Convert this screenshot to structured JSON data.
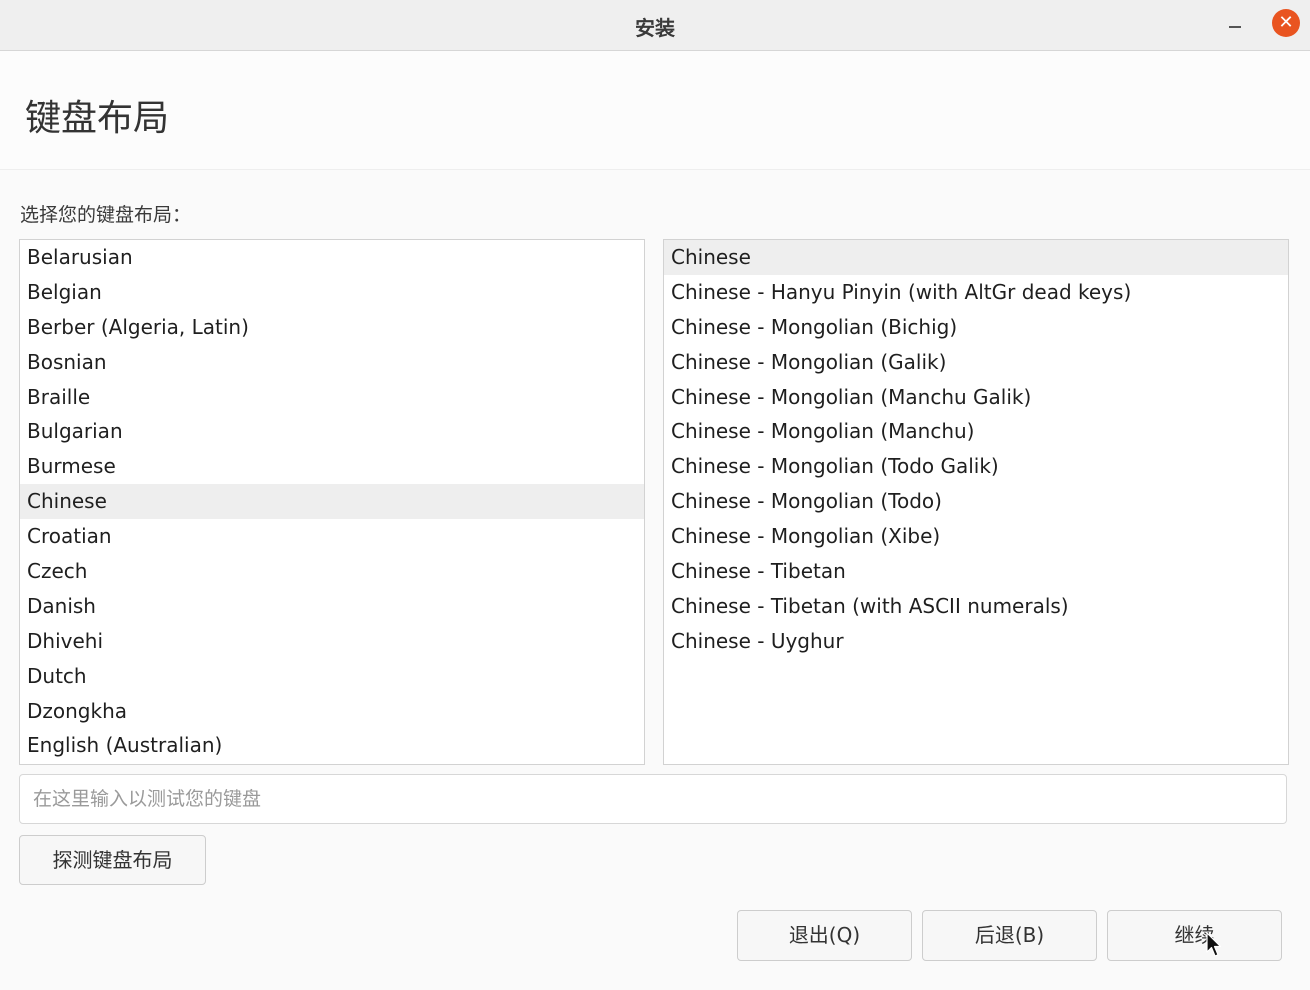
{
  "window": {
    "title": "安装"
  },
  "header": {
    "title": "键盘布局"
  },
  "prompt": "选择您的键盘布局：",
  "layouts": [
    "Belarusian",
    "Belgian",
    "Berber (Algeria, Latin)",
    "Bosnian",
    "Braille",
    "Bulgarian",
    "Burmese",
    "Chinese",
    "Croatian",
    "Czech",
    "Danish",
    "Dhivehi",
    "Dutch",
    "Dzongkha",
    "English (Australian)"
  ],
  "selected_layout": "Chinese",
  "variants": [
    "Chinese",
    "Chinese - Hanyu Pinyin (with AltGr dead keys)",
    "Chinese - Mongolian (Bichig)",
    "Chinese - Mongolian (Galik)",
    "Chinese - Mongolian (Manchu Galik)",
    "Chinese - Mongolian (Manchu)",
    "Chinese - Mongolian (Todo Galik)",
    "Chinese - Mongolian (Todo)",
    "Chinese - Mongolian (Xibe)",
    "Chinese - Tibetan",
    "Chinese - Tibetan (with ASCII numerals)",
    "Chinese - Uyghur"
  ],
  "selected_variant": "Chinese",
  "test_input": {
    "placeholder": "在这里输入以测试您的键盘",
    "value": ""
  },
  "buttons": {
    "detect": "探测键盘布局",
    "quit": "退出(Q)",
    "back": "后退(B)",
    "continue": "继续"
  },
  "icons": {
    "minimize": "minimize-icon",
    "close": "close-icon",
    "cursor": "mouse-pointer-icon"
  },
  "colors": {
    "close_button": "#e95420",
    "selection": "#eeeeee"
  }
}
